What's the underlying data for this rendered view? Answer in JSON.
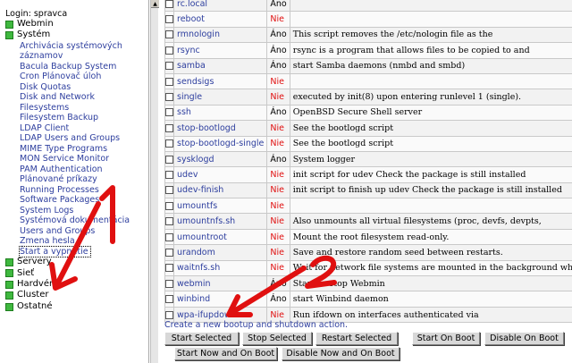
{
  "sidebar": {
    "login_label": "Login: spravca",
    "categories_top": [
      {
        "label": "Webmin"
      },
      {
        "label": "Systém"
      }
    ],
    "system_items": [
      "Archivácia systémových",
      "záznamov",
      "Bacula Backup System",
      "Cron Plánovač úloh",
      "Disk Quotas",
      "Disk and Network",
      "Filesystems",
      "Filesystem Backup",
      "LDAP Client",
      "LDAP Users and Groups",
      "MIME Type Programs",
      "MON Service Monitor",
      "PAM Authentication",
      "Plánované príkazy",
      "Running Processes",
      "Software Packages",
      "System Logs",
      "Systémová dokumentácia",
      "Users and Groups",
      "Zmena hesla"
    ],
    "selected_item": "Štart a vypnutie",
    "categories_bottom": [
      {
        "label": "Servery"
      },
      {
        "label": "Sieť"
      },
      {
        "label": "Hardvér"
      },
      {
        "label": "Cluster"
      },
      {
        "label": "Ostatné"
      }
    ],
    "category_color": "#3fb83f"
  },
  "services": [
    {
      "name": "rc.local",
      "boot": "Áno",
      "desc": ""
    },
    {
      "name": "reboot",
      "boot": "Nie",
      "desc": ""
    },
    {
      "name": "rmnologin",
      "boot": "Áno",
      "desc": "This script removes the /etc/nologin file as the"
    },
    {
      "name": "rsync",
      "boot": "Áno",
      "desc": "rsync is a program that allows files to be copied to and"
    },
    {
      "name": "samba",
      "boot": "Áno",
      "desc": "start Samba daemons (nmbd and smbd)"
    },
    {
      "name": "sendsigs",
      "boot": "Nie",
      "desc": ""
    },
    {
      "name": "single",
      "boot": "Nie",
      "desc": "executed by init(8) upon entering runlevel 1 (single)."
    },
    {
      "name": "ssh",
      "boot": "Áno",
      "desc": "OpenBSD Secure Shell server"
    },
    {
      "name": "stop-bootlogd",
      "boot": "Nie",
      "desc": "See the bootlogd script"
    },
    {
      "name": "stop-bootlogd-single",
      "boot": "Nie",
      "desc": "See the bootlogd script"
    },
    {
      "name": "sysklogd",
      "boot": "Áno",
      "desc": "System logger"
    },
    {
      "name": "udev",
      "boot": "Nie",
      "desc": "init script for udev Check the package is still installed"
    },
    {
      "name": "udev-finish",
      "boot": "Nie",
      "desc": "init script to finish up udev Check the package is still installed"
    },
    {
      "name": "umountfs",
      "boot": "Nie",
      "desc": ""
    },
    {
      "name": "umountnfs.sh",
      "boot": "Nie",
      "desc": "Also unmounts all virtual filesystems (proc, devfs, devpts,"
    },
    {
      "name": "umountroot",
      "boot": "Nie",
      "desc": "Mount the root filesystem read-only."
    },
    {
      "name": "urandom",
      "boot": "Nie",
      "desc": "Save and restore random seed between restarts."
    },
    {
      "name": "waitnfs.sh",
      "boot": "Nie",
      "desc": "Wait for network file systems are mounted in the background when"
    },
    {
      "name": "webmin",
      "boot": "Áno",
      "desc": "Start or stop Webmin"
    },
    {
      "name": "winbind",
      "boot": "Áno",
      "desc": "start Winbind daemon"
    },
    {
      "name": "wpa-ifupdown",
      "boot": "Nie",
      "desc": "Run ifdown on interfaces authenticated via"
    }
  ],
  "create_link": "Create a new bootup and shutdown action.",
  "buttons": {
    "start_selected": "Start Selected",
    "stop_selected": "Stop Selected",
    "restart_selected": "Restart Selected",
    "start_on_boot": "Start On Boot",
    "disable_on_boot": "Disable On Boot",
    "start_now_and_on_boot": "Start Now and On Boot",
    "disable_now_and_on_boot": "Disable Now and On Boot"
  },
  "annotations": {
    "label_1": "1",
    "label_2": "2",
    "color": "#e01010"
  },
  "colors": {
    "link": "#2d3e9e",
    "no": "#e01010"
  }
}
